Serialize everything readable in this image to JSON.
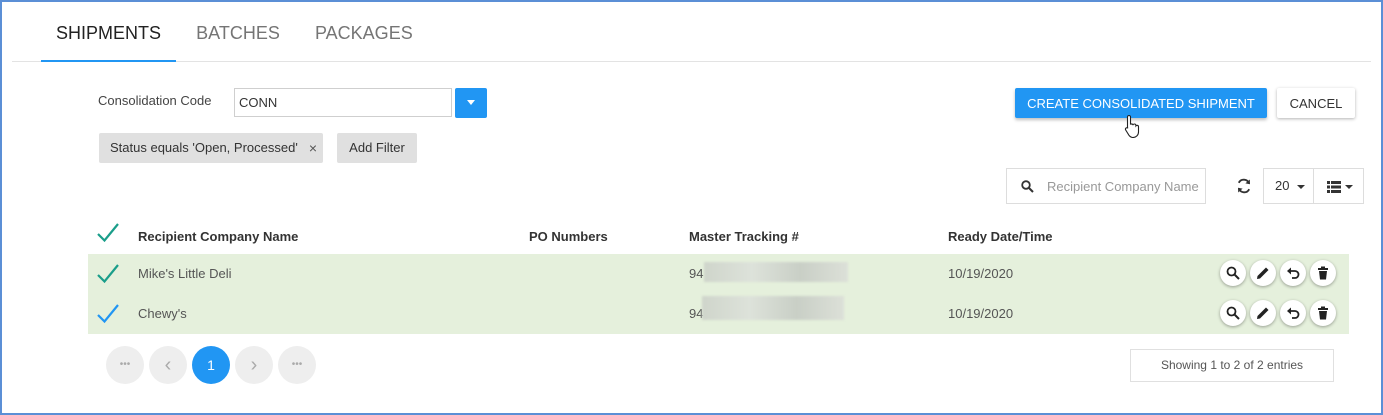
{
  "tabs": [
    {
      "label": "SHIPMENTS",
      "active": true
    },
    {
      "label": "BATCHES",
      "active": false
    },
    {
      "label": "PACKAGES",
      "active": false
    }
  ],
  "consolidation": {
    "label": "Consolidation Code",
    "value": "CONN"
  },
  "filters": {
    "status_chip": "Status equals 'Open, Processed'",
    "remove_icon": "×",
    "add_label": "Add Filter"
  },
  "actions": {
    "create_label": "CREATE CONSOLIDATED SHIPMENT",
    "cancel_label": "CANCEL"
  },
  "search": {
    "placeholder": "Recipient Company Name"
  },
  "page_size": "20",
  "table": {
    "columns": [
      "Recipient Company Name",
      "PO Numbers",
      "Master Tracking #",
      "Ready Date/Time"
    ],
    "rows": [
      {
        "company": "Mike's Little Deli",
        "po": "",
        "tracking": "94",
        "ready": "10/19/2020",
        "check_color": "#1a9e8a"
      },
      {
        "company": "Chewy's",
        "po": "",
        "tracking": "94",
        "ready": "10/19/2020",
        "check_color": "#2196f3"
      }
    ]
  },
  "pagination": {
    "first": "•••",
    "prev": "‹",
    "current": "1",
    "next": "›",
    "last": "•••",
    "summary": "Showing 1 to 2 of 2 entries"
  },
  "colors": {
    "accent": "#2196f3",
    "row_highlight": "#e5f0dc",
    "header_check": "#1a9e8a"
  },
  "icons": {
    "search": "search-icon",
    "refresh": "refresh-icon",
    "column_list": "list-icon",
    "view": "search-icon",
    "edit": "pencil-icon",
    "undo": "undo-icon",
    "delete": "trash-icon",
    "cursor": "hand-pointer-icon"
  }
}
